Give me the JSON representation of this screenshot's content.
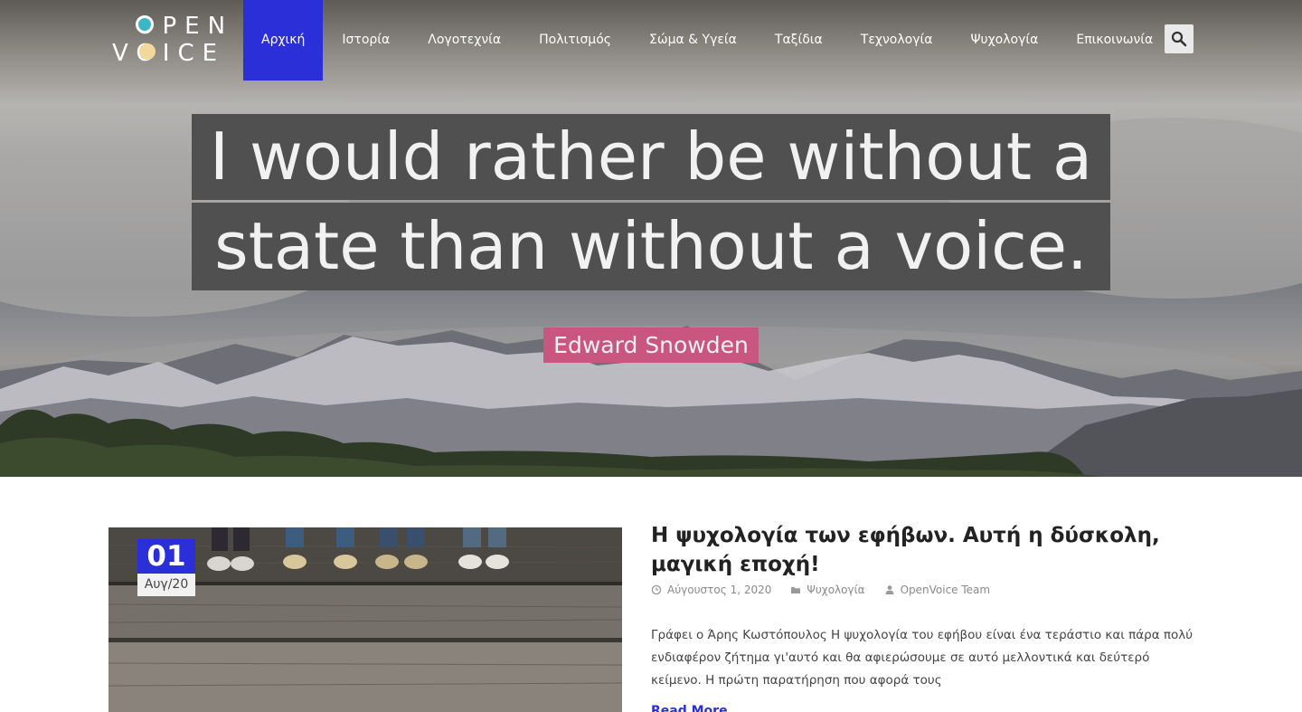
{
  "logo": {
    "line1": "OPEN",
    "line2": "VOICE"
  },
  "nav": {
    "items": [
      {
        "label": "Αρχική"
      },
      {
        "label": "Ιστορία"
      },
      {
        "label": "Λογοτεχνία"
      },
      {
        "label": "Πολιτισμός"
      },
      {
        "label": "Σώμα & Υγεία"
      },
      {
        "label": "Ταξίδια"
      },
      {
        "label": "Τεχνολογία"
      },
      {
        "label": "Ψυχολογία"
      },
      {
        "label": "Επικοινωνία"
      }
    ],
    "active": "Αρχική"
  },
  "search": {
    "icon": "search-icon"
  },
  "hero": {
    "quote_line1": "I would rather be without a",
    "quote_line2": "state than without a voice.",
    "author": "Edward Snowden"
  },
  "post": {
    "date_day": "01",
    "date_month": "Αυγ/20",
    "title": "Η ψυχολογία των εφήβων. Αυτή η δύσκολη, μαγική εποχή!",
    "meta": {
      "date": "Αύγουστος 1, 2020",
      "category": "Ψυχολογία",
      "author": "OpenVoice Team"
    },
    "excerpt": " Γράφει ο Άρης Κωστόπουλος Η ψυχολογία του εφήβου είναι ένα τεράστιο και πάρα πολύ ενδιαφέρον ζήτημα γι'αυτό και θα αφιερώσουμε σε αυτό μελλοντικά και δεύτερό κείμενο.  Η πρώτη παρατήρηση που αφορά τους",
    "read_more": "Read More"
  },
  "colors": {
    "accent": "#2b2fd7",
    "author_badge": "#c8567f",
    "quote_box": "#505050"
  }
}
